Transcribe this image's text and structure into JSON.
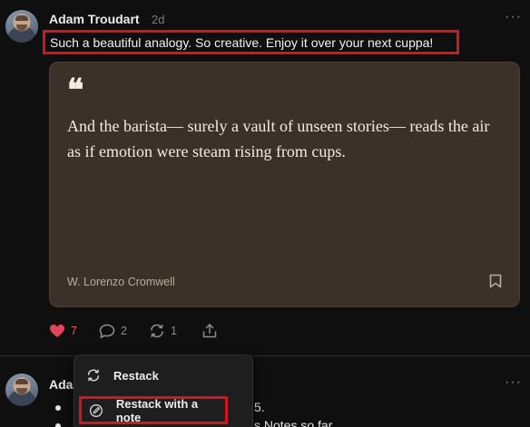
{
  "post": {
    "author": "Adam Troudart",
    "time": "2d",
    "more_label": "···",
    "text": "Such a beautiful analogy. So creative. Enjoy it over your next cuppa!"
  },
  "quote": {
    "mark": "❝",
    "text": "And the barista— surely a vault of unseen stories— reads the air as if emotion were steam rising from cups.",
    "author": "W. Lorenzo Cromwell"
  },
  "actions": {
    "likes": "7",
    "comments": "2",
    "restacks": "1"
  },
  "next_post": {
    "author_partial": "Ada",
    "more_label": "···",
    "bullet1_fragment": "5.",
    "bullet2_fragment": "s Notes so far."
  },
  "menu": {
    "items": [
      {
        "label": "Restack"
      },
      {
        "label": "Restack with a note"
      }
    ]
  },
  "colors": {
    "highlight": "#d4151b",
    "like": "#e05a6a",
    "card_bg": "#3b3128"
  }
}
